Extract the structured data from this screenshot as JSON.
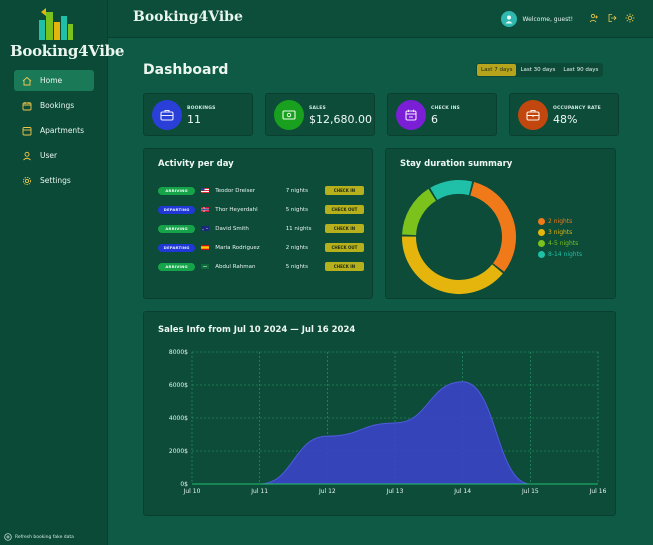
{
  "app": {
    "brand": "Booking4Vibe",
    "logo_text": "Booking4Vibe"
  },
  "sidebar": {
    "items": [
      {
        "label": "Home",
        "icon": "home-icon",
        "active": true
      },
      {
        "label": "Bookings",
        "icon": "calendar-icon",
        "active": false
      },
      {
        "label": "Apartments",
        "icon": "building-icon",
        "active": false
      },
      {
        "label": "User",
        "icon": "user-icon",
        "active": false
      },
      {
        "label": "Settings",
        "icon": "gear-icon",
        "active": false
      }
    ],
    "refresh_label": "Refresh booking fake data"
  },
  "header": {
    "welcome": "Welcome, guest!",
    "icons": [
      "user-plus-icon",
      "logout-icon",
      "sun-icon"
    ]
  },
  "dashboard": {
    "title": "Dashboard",
    "ranges": [
      {
        "label": "Last 7 days",
        "active": true
      },
      {
        "label": "Last 30 days",
        "active": false
      },
      {
        "label": "Last 90 days",
        "active": false
      }
    ],
    "stats": [
      {
        "label": "BOOKINGS",
        "value": "11",
        "color": "#2a3fd8",
        "icon": "briefcase-icon"
      },
      {
        "label": "SALES",
        "value": "$12,680.00",
        "color": "#18a01e",
        "icon": "money-icon"
      },
      {
        "label": "CHECK INS",
        "value": "6",
        "color": "#7a1fd6",
        "icon": "calendar-check-icon"
      },
      {
        "label": "OCCUPANCY RATE",
        "value": "48%",
        "color": "#c2470f",
        "icon": "bag-icon"
      }
    ]
  },
  "activity": {
    "title": "Activity per day",
    "rows": [
      {
        "status": "ARRIVING",
        "guest": "Teodor Dreiser",
        "nights": "7 nights",
        "action": "CHECK IN",
        "flag": "us"
      },
      {
        "status": "DEPARTING",
        "guest": "Thor Heyerdahl",
        "nights": "5 nights",
        "action": "CHECK OUT",
        "flag": "no"
      },
      {
        "status": "ARRIVING",
        "guest": "David Smith",
        "nights": "11 nights",
        "action": "CHECK IN",
        "flag": "au"
      },
      {
        "status": "DEPARTING",
        "guest": "Maria Rodriguez",
        "nights": "2 nights",
        "action": "CHECK OUT",
        "flag": "es"
      },
      {
        "status": "ARRIVING",
        "guest": "Abdul Rahman",
        "nights": "5 nights",
        "action": "CHECK IN",
        "flag": "sa"
      }
    ],
    "colors": {
      "arriving": "#17a34a",
      "departing": "#2039d6",
      "button": "#b6b01c"
    }
  },
  "stay": {
    "title": "Stay duration summary",
    "legend": [
      {
        "label": "2 nights",
        "value": 4,
        "color": "#f07a1a"
      },
      {
        "label": "3 nights",
        "value": 5,
        "color": "#e5b50e"
      },
      {
        "label": "4-5 nights",
        "value": 2,
        "color": "#7cc21c"
      },
      {
        "label": "8-14 nights",
        "value": 1.6,
        "color": "#1fbfa8"
      }
    ]
  },
  "sales": {
    "title": "Sales Info from Jul 10 2024 — Jul 16 2024"
  },
  "chart_data": {
    "type": "area",
    "title": "Sales Info from Jul 10 2024 — Jul 16 2024",
    "x": [
      "Jul 10",
      "Jul 11",
      "Jul 12",
      "Jul 13",
      "Jul 14",
      "Jul 15",
      "Jul 16"
    ],
    "series": [
      {
        "values": [
          0,
          0,
          2900,
          3700,
          6200,
          0,
          0
        ],
        "color": "#3a45c8"
      }
    ],
    "y_ticks": [
      "0$",
      "2000$",
      "4000$",
      "6000$",
      "8000$"
    ],
    "ylim": [
      0,
      8000
    ],
    "grid": true
  }
}
